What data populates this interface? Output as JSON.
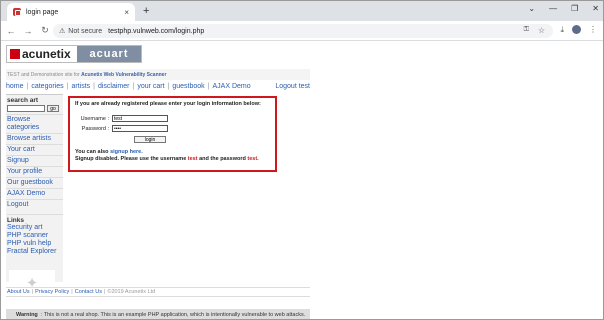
{
  "browser": {
    "tab_title": "login page",
    "tab_close": "×",
    "new_tab": "+",
    "security_label": "Not secure",
    "url": "testphp.vulnweb.com/login.php"
  },
  "site": {
    "logo_left": "acunetix",
    "logo_right": "acuart",
    "tagline_prefix": "TEST and Demonstration site for",
    "tagline_link": "Acunetix Web Vulnerability Scanner"
  },
  "menu": {
    "items": [
      "home",
      "categories",
      "artists",
      "disclaimer",
      "your cart",
      "guestbook",
      "AJAX Demo"
    ],
    "logout": "Logout test"
  },
  "sidebar": {
    "search_heading": "search art",
    "go_label": "go",
    "links": [
      "Browse categories",
      "Browse artists",
      "Your cart",
      "Signup",
      "Your profile",
      "Our guestbook",
      "AJAX Demo",
      "Logout"
    ],
    "links_heading": "Links",
    "external_links": [
      "Security art",
      "PHP scanner",
      "PHP vuln help",
      "Fractal Explorer"
    ]
  },
  "login": {
    "intro": "If you are already registered please enter your login information below:",
    "username_label": "Username :",
    "username_value": "test",
    "password_label": "Password :",
    "password_value": "••••",
    "button_label": "login",
    "also_prefix": "You can also",
    "signup_link": "signup here.",
    "disabled_prefix": "Signup disabled. Please use the username",
    "disabled_user": "test",
    "disabled_mid": "and the password",
    "disabled_pass": "test."
  },
  "footer": {
    "about": "About Us",
    "privacy": "Privacy Policy",
    "contact": "Contact Us",
    "copyright": "©2019 Acunetix Ltd",
    "sep": "|"
  },
  "warning": {
    "label": "Warning",
    "text": ": This is not a real shop. This is an example PHP application, which is intentionally vulnerable to web attacks."
  }
}
